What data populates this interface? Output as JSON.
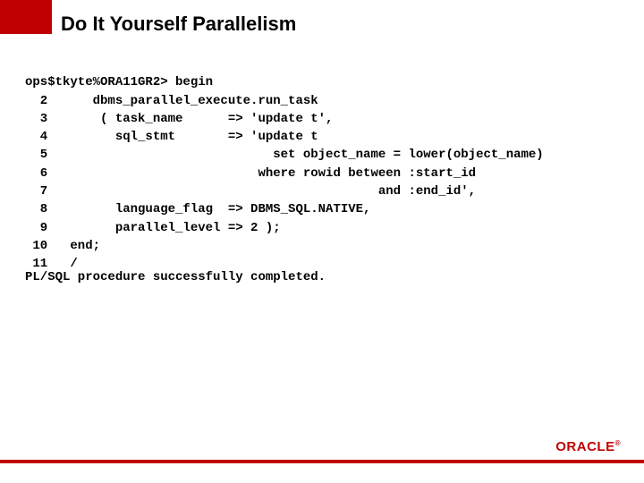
{
  "title": "Do It Yourself Parallelism",
  "code": {
    "line0": "ops$tkyte%ORA11GR2> begin",
    "line1": "  2      dbms_parallel_execute.run_task",
    "line2": "  3       ( task_name      => 'update t',",
    "line3": "  4         sql_stmt       => 'update t",
    "line4": "  5                              set object_name = lower(object_name)",
    "line5": "  6                            where rowid between :start_id",
    "line6": "  7                                            and :end_id',",
    "line7": "  8         language_flag  => DBMS_SQL.NATIVE,",
    "line8": "  9         parallel_level => 2 );",
    "line9": " 10   end;",
    "line10": " 11   /"
  },
  "status": "PL/SQL procedure successfully completed.",
  "logo": "ORACLE"
}
